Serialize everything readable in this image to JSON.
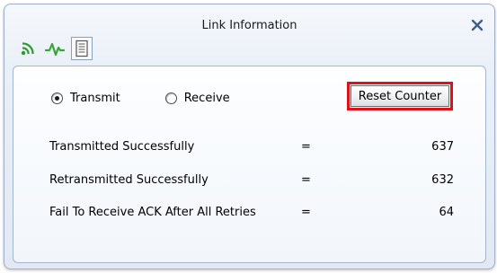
{
  "window": {
    "title": "Link Information",
    "close_icon": "close-x-icon"
  },
  "toolbar": {
    "items": [
      {
        "icon": "signal-wave-icon",
        "color": "#2c9b2c",
        "active": false
      },
      {
        "icon": "pulse-graph-icon",
        "color": "#3aa33a",
        "active": false
      },
      {
        "icon": "document-list-icon",
        "color": "#555555",
        "active": true
      }
    ]
  },
  "mode": {
    "options": [
      {
        "label": "Transmit",
        "checked": true
      },
      {
        "label": "Receive",
        "checked": false
      }
    ]
  },
  "reset_button": {
    "label": "Reset Counter",
    "highlight_color": "#e0101a"
  },
  "stats": {
    "equals": "=",
    "rows": [
      {
        "label": "Transmitted Successfully",
        "value": "637"
      },
      {
        "label": "Retransmitted Successfully",
        "value": "632"
      },
      {
        "label": "Fail To Receive ACK After All Retries",
        "value": "64"
      }
    ]
  }
}
